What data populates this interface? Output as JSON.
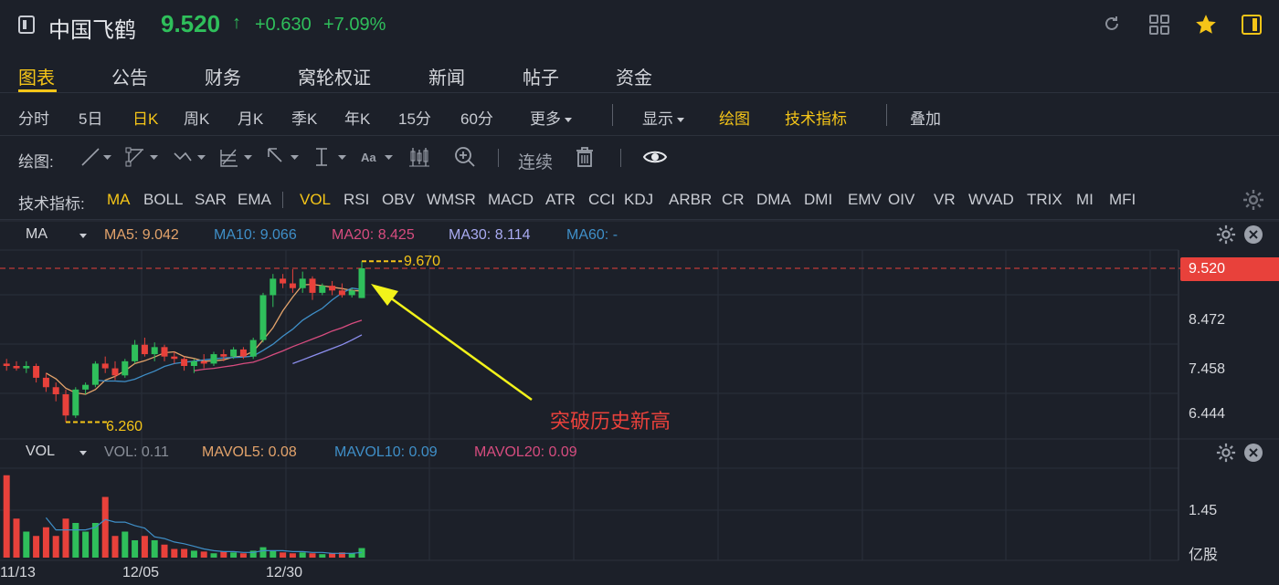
{
  "header": {
    "stock_name": "中国飞鹤",
    "price": "9.520",
    "change": "+0.630",
    "change_pct": "+7.09%",
    "up_color": "#2fbf5b",
    "accent": "#f5c518"
  },
  "tabs": [
    {
      "label": "图表",
      "active": true
    },
    {
      "label": "公告"
    },
    {
      "label": "财务"
    },
    {
      "label": "窝轮权证"
    },
    {
      "label": "新闻"
    },
    {
      "label": "帖子"
    },
    {
      "label": "资金"
    }
  ],
  "periods": {
    "items": [
      "分时",
      "5日",
      "日K",
      "周K",
      "月K",
      "季K",
      "年K",
      "15分",
      "60分"
    ],
    "active": "日K",
    "more": "更多",
    "display": "显示",
    "draw": "绘图",
    "indicators": "技术指标",
    "overlay": "叠加"
  },
  "drawing_tools": {
    "label": "绘图:",
    "continuous": "连续"
  },
  "indicator_bar": {
    "label": "技术指标:",
    "main": [
      "MA",
      "BOLL",
      "SAR",
      "EMA"
    ],
    "sub": [
      "VOL",
      "RSI",
      "OBV",
      "WMSR",
      "MACD",
      "ATR",
      "CCI",
      "KDJ",
      "ARBR",
      "CR",
      "DMA",
      "DMI",
      "EMV",
      "OIV",
      "VR",
      "WVAD",
      "TRIX",
      "MI",
      "MFI"
    ],
    "active_main": "MA",
    "active_sub": "VOL"
  },
  "ma_panel": {
    "name": "MA",
    "ma5": "MA5: 9.042",
    "ma10": "MA10: 9.066",
    "ma20": "MA20: 8.425",
    "ma30": "MA30: 8.114",
    "ma60": "MA60: -",
    "colors": {
      "ma5": "#e3a36b",
      "ma10": "#3f8fc8",
      "ma20": "#d74c7f",
      "ma30": "#8d8ff0",
      "ma60": "#3f8fc8"
    }
  },
  "price_axis": {
    "current": "9.520",
    "ticks": [
      "8.472",
      "7.458",
      "6.444"
    ]
  },
  "annotations": {
    "high": "9.670",
    "low": "6.260",
    "note": "突破历史新高"
  },
  "vol_panel": {
    "name": "VOL",
    "vol": "VOL: 0.11",
    "mavol5": "MAVOL5: 0.08",
    "mavol10": "MAVOL10: 0.09",
    "mavol20": "MAVOL20: 0.09",
    "axis_tick": "1.45",
    "unit": "亿股"
  },
  "date_axis": [
    "11/13",
    "12/05",
    "12/30"
  ],
  "chart_data": {
    "type": "candlestick",
    "series": [
      {
        "name": "K",
        "ohlc": [
          [
            7.5,
            7.6,
            7.35,
            7.45
          ],
          [
            7.45,
            7.55,
            7.35,
            7.4
          ],
          [
            7.4,
            7.55,
            7.3,
            7.45
          ],
          [
            7.45,
            7.5,
            7.1,
            7.2
          ],
          [
            7.2,
            7.3,
            6.9,
            7.0
          ],
          [
            7.0,
            7.1,
            6.7,
            6.85
          ],
          [
            6.85,
            6.95,
            6.26,
            6.4
          ],
          [
            6.4,
            7.0,
            6.35,
            6.95
          ],
          [
            6.95,
            7.1,
            6.85,
            7.05
          ],
          [
            7.05,
            7.55,
            7.0,
            7.5
          ],
          [
            7.5,
            7.65,
            7.3,
            7.4
          ],
          [
            7.4,
            7.55,
            7.15,
            7.25
          ],
          [
            7.25,
            7.6,
            7.2,
            7.55
          ],
          [
            7.55,
            8.0,
            7.5,
            7.9
          ],
          [
            7.9,
            8.05,
            7.65,
            7.7
          ],
          [
            7.7,
            7.95,
            7.55,
            7.85
          ],
          [
            7.85,
            7.9,
            7.55,
            7.65
          ],
          [
            7.65,
            7.75,
            7.5,
            7.6
          ],
          [
            7.6,
            7.65,
            7.35,
            7.45
          ],
          [
            7.45,
            7.6,
            7.3,
            7.55
          ],
          [
            7.55,
            7.7,
            7.4,
            7.5
          ],
          [
            7.5,
            7.75,
            7.45,
            7.7
          ],
          [
            7.7,
            7.8,
            7.55,
            7.65
          ],
          [
            7.65,
            7.85,
            7.6,
            7.8
          ],
          [
            7.8,
            7.85,
            7.6,
            7.65
          ],
          [
            7.65,
            8.05,
            7.6,
            8.0
          ],
          [
            8.0,
            9.0,
            7.95,
            8.95
          ],
          [
            8.95,
            9.4,
            8.7,
            9.3
          ],
          [
            9.3,
            9.4,
            9.1,
            9.2
          ],
          [
            9.2,
            9.5,
            9.0,
            9.1
          ],
          [
            9.1,
            9.45,
            9.0,
            9.3
          ],
          [
            9.3,
            9.35,
            8.85,
            9.0
          ],
          [
            9.0,
            9.2,
            8.95,
            9.15
          ],
          [
            9.15,
            9.25,
            8.95,
            9.05
          ],
          [
            9.05,
            9.2,
            8.9,
            8.95
          ],
          [
            8.95,
            9.1,
            8.9,
            9.05
          ],
          [
            8.89,
            9.67,
            8.89,
            9.52
          ]
        ]
      },
      {
        "name": "MA5",
        "values": [
          null,
          null,
          null,
          null,
          7.3,
          7.18,
          6.98,
          6.88,
          6.85,
          6.95,
          7.15,
          7.23,
          7.35,
          7.5,
          7.56,
          7.64,
          7.73,
          7.75,
          7.65,
          7.61,
          7.55,
          7.56,
          7.58,
          7.64,
          7.66,
          7.76,
          8.0,
          8.26,
          8.62,
          8.91,
          9.17,
          9.18,
          9.15,
          9.12,
          9.09,
          9.05,
          9.04
        ]
      },
      {
        "name": "MA10",
        "values": [
          null,
          null,
          null,
          null,
          null,
          null,
          null,
          null,
          null,
          7.15,
          7.13,
          7.13,
          7.12,
          7.17,
          7.26,
          7.34,
          7.44,
          7.5,
          7.53,
          7.55,
          7.58,
          7.6,
          7.62,
          7.63,
          7.64,
          7.66,
          7.78,
          7.91,
          8.08,
          8.23,
          8.42,
          8.55,
          8.67,
          8.85,
          9.0,
          9.1,
          9.07
        ]
      },
      {
        "name": "MA20",
        "values": [
          null,
          null,
          null,
          null,
          null,
          null,
          null,
          null,
          null,
          null,
          null,
          null,
          null,
          null,
          null,
          null,
          null,
          null,
          null,
          7.35,
          7.38,
          7.4,
          7.43,
          7.46,
          7.5,
          7.53,
          7.6,
          7.69,
          7.77,
          7.86,
          7.94,
          8.02,
          8.1,
          8.19,
          8.26,
          8.35,
          8.42
        ]
      },
      {
        "name": "MA30",
        "values": [
          null,
          null,
          null,
          null,
          null,
          null,
          null,
          null,
          null,
          null,
          null,
          null,
          null,
          null,
          null,
          null,
          null,
          null,
          null,
          null,
          null,
          null,
          null,
          null,
          null,
          null,
          null,
          null,
          null,
          7.5,
          7.58,
          7.66,
          7.74,
          7.82,
          7.9,
          8.0,
          8.11
        ]
      }
    ],
    "volume": [
      0.95,
      0.45,
      0.3,
      0.25,
      0.35,
      0.25,
      0.45,
      0.4,
      0.3,
      0.4,
      0.7,
      0.25,
      0.3,
      0.2,
      0.25,
      0.2,
      0.15,
      0.1,
      0.1,
      0.08,
      0.07,
      0.05,
      0.07,
      0.06,
      0.05,
      0.08,
      0.12,
      0.08,
      0.06,
      0.05,
      0.06,
      0.05,
      0.04,
      0.05,
      0.06,
      0.05,
      0.11
    ],
    "volume_ma": [
      null,
      null,
      null,
      null,
      0.46,
      0.32,
      0.32,
      0.32,
      0.32,
      0.35,
      0.44,
      0.41,
      0.41,
      0.37,
      0.34,
      0.24,
      0.22,
      0.18,
      0.16,
      0.13,
      0.1,
      0.08,
      0.07,
      0.07,
      0.06,
      0.06,
      0.08,
      0.08,
      0.08,
      0.07,
      0.07,
      0.06,
      0.06,
      0.05,
      0.05,
      0.05,
      0.06
    ],
    "ylim": [
      6.0,
      9.9
    ],
    "xlabel": "",
    "ylabel": ""
  }
}
